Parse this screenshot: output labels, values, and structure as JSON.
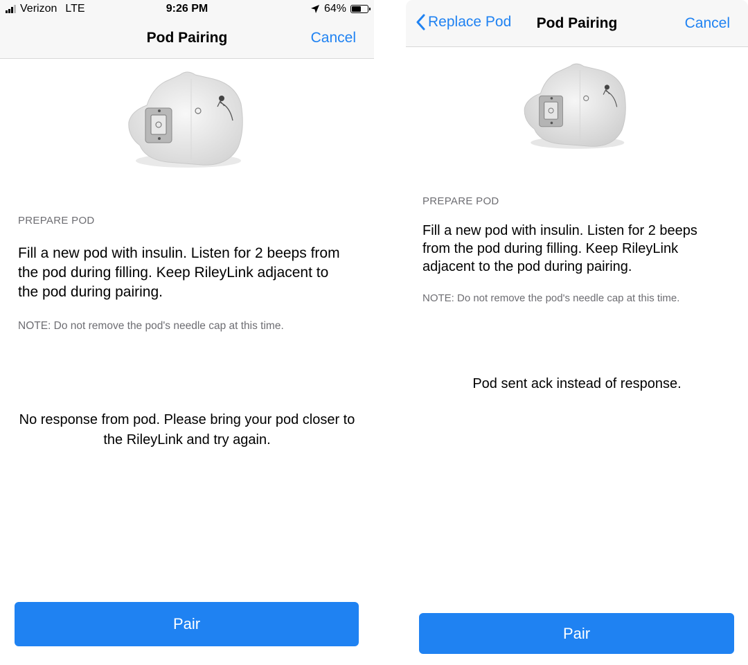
{
  "left_screen": {
    "status_bar": {
      "carrier": "Verizon",
      "network": "LTE",
      "time": "9:26 PM",
      "battery_percent": "64%",
      "battery_level": 0.64,
      "icons": [
        "signal-icon",
        "location-arrow-icon",
        "battery-icon"
      ]
    },
    "nav": {
      "title": "Pod Pairing",
      "cancel_label": "Cancel"
    },
    "section_header": "PREPARE POD",
    "instructions": "Fill a new pod with insulin. Listen for 2 beeps from the pod during filling. Keep RileyLink adjacent to the pod during pairing.",
    "note": "NOTE: Do not remove the pod's needle cap at this time.",
    "status_message": "No response from pod. Please bring your pod closer to the RileyLink and try again.",
    "pair_label": "Pair"
  },
  "right_screen": {
    "nav": {
      "back_label": "Replace Pod",
      "title": "Pod Pairing",
      "cancel_label": "Cancel"
    },
    "section_header": "PREPARE POD",
    "instructions": "Fill a new pod with insulin. Listen for 2 beeps from the pod during filling. Keep RileyLink adjacent to the pod during pairing.",
    "note": "NOTE: Do not remove the pod's needle cap at this time.",
    "status_message": "Pod sent ack instead of response.",
    "pair_label": "Pair"
  },
  "colors": {
    "accent": "#1f82f2",
    "nav_background": "#f7f7f7",
    "secondary_text": "#6d6d72"
  }
}
